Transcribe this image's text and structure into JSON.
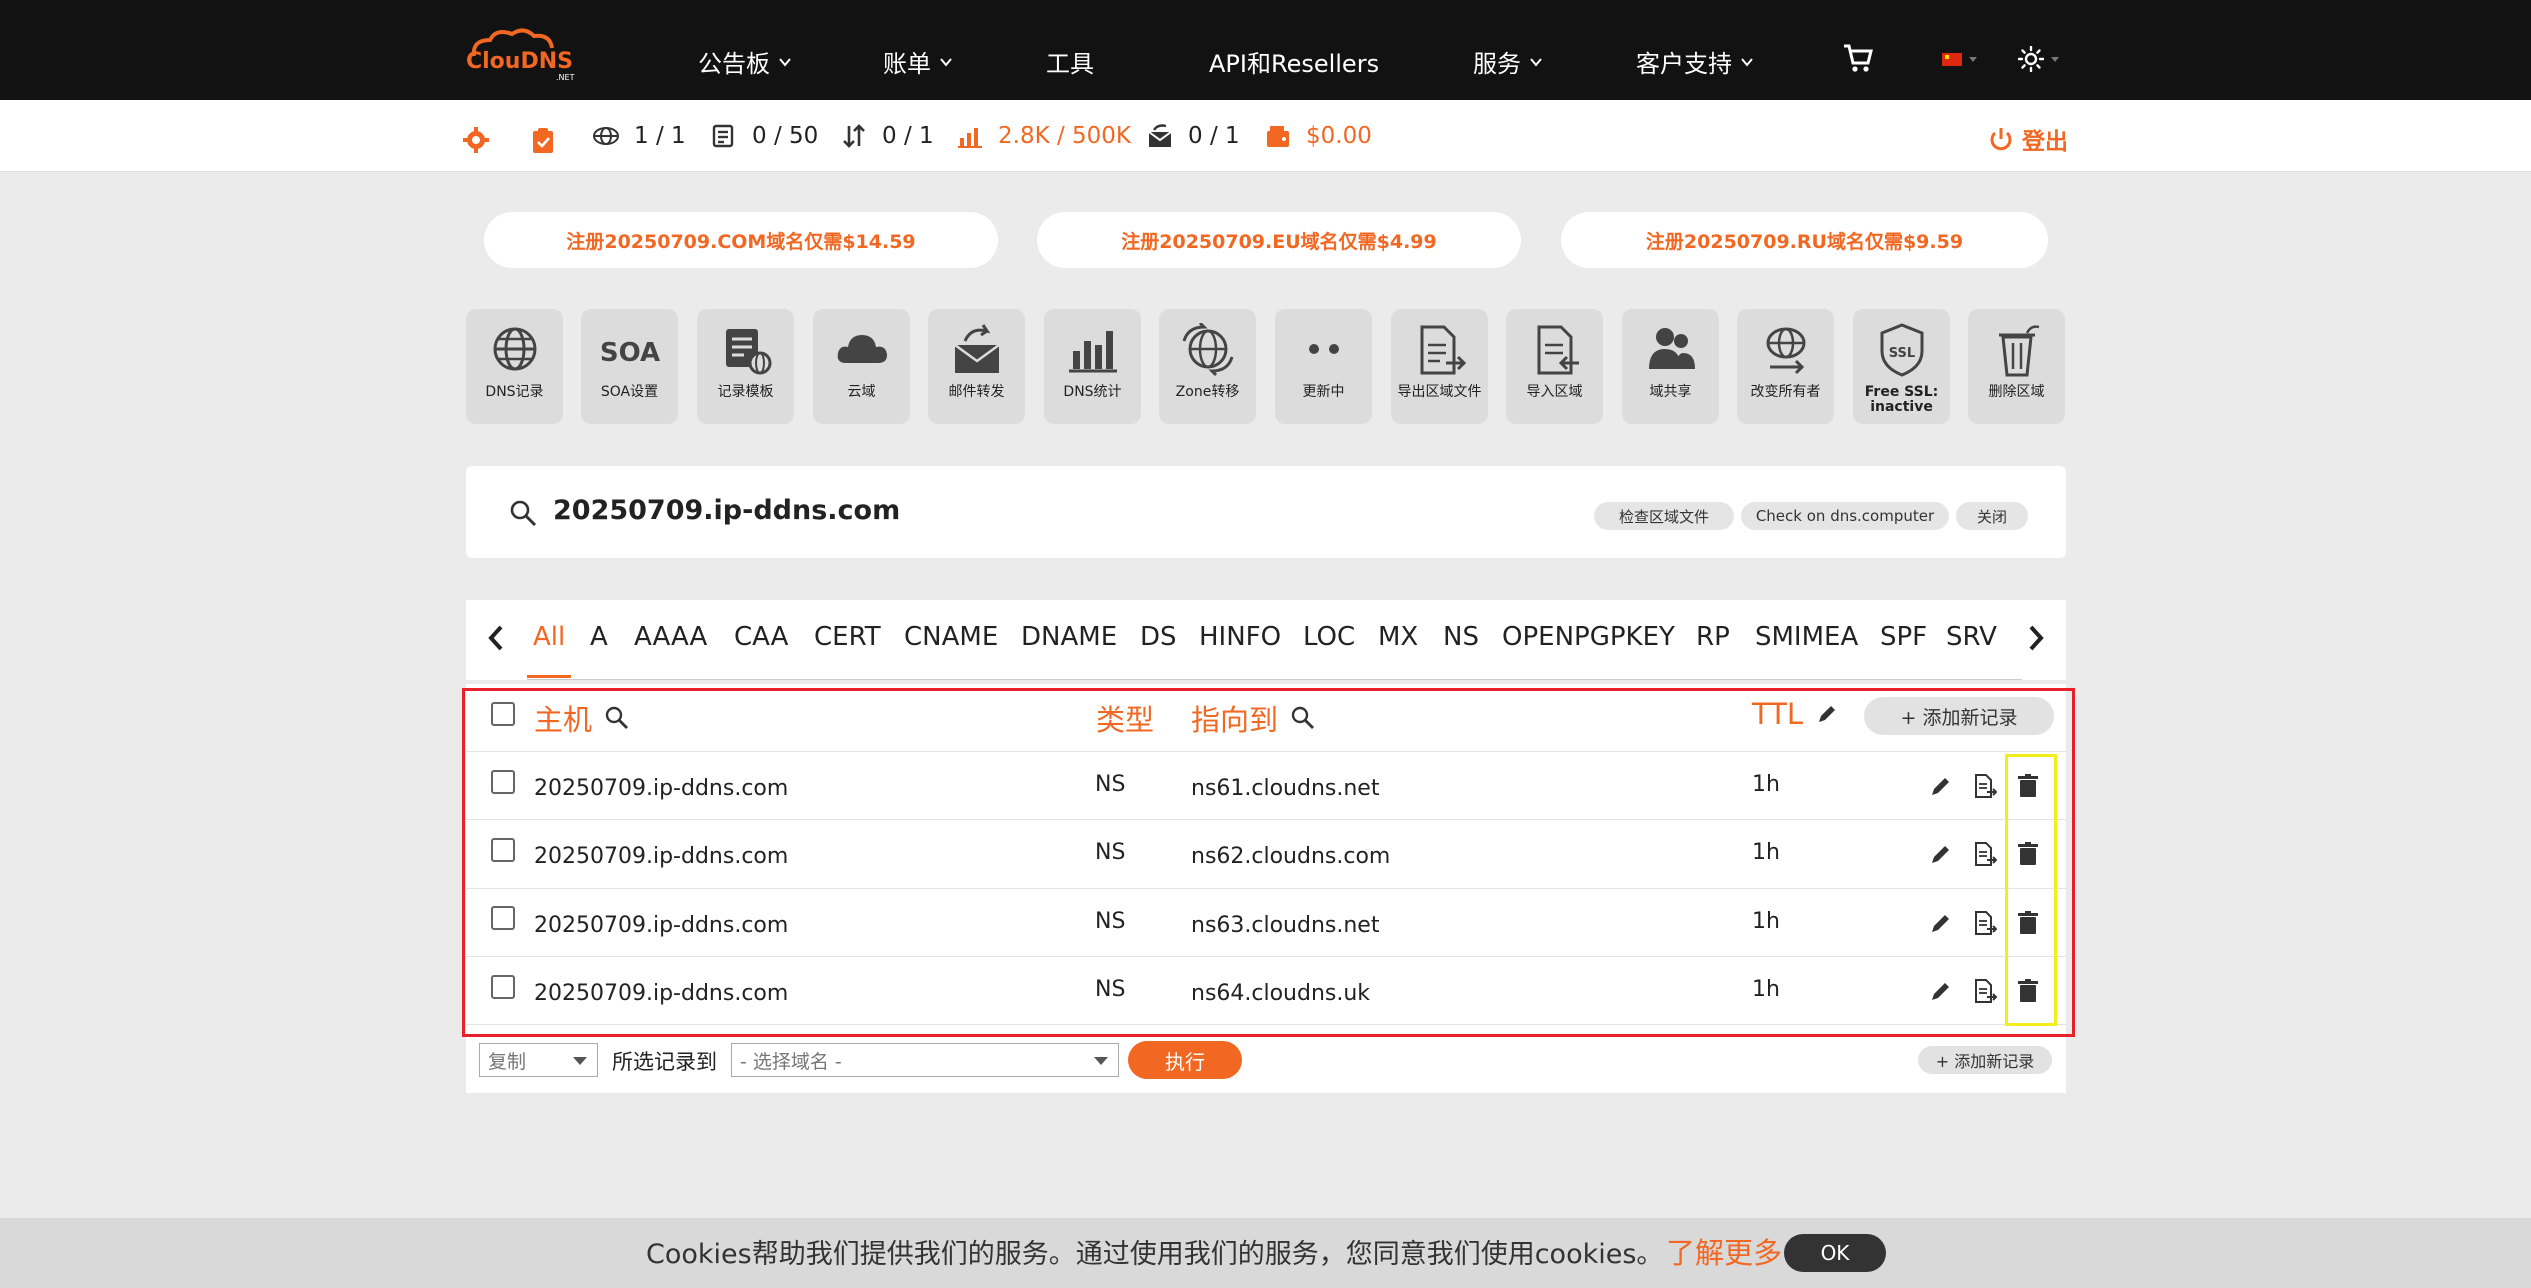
{
  "brand": {
    "logo_text": "ClouDNS",
    "logo_sub": ".NET"
  },
  "nav": {
    "items": [
      {
        "label": "公告板",
        "has_dropdown": true
      },
      {
        "label": "账单",
        "has_dropdown": true
      },
      {
        "label": "工具",
        "has_dropdown": false
      },
      {
        "label": "API和Resellers",
        "has_dropdown": false
      },
      {
        "label": "服务",
        "has_dropdown": true
      },
      {
        "label": "客户支持",
        "has_dropdown": true
      }
    ],
    "icons": [
      "cart-icon",
      "flag-cn-icon",
      "theme-sun-icon"
    ]
  },
  "stats": {
    "zones": "1 / 1",
    "records": "0 / 50",
    "transfers": "0 / 1",
    "queries": "2.8K / 500K",
    "mail_forwards": "0 / 1",
    "balance": "$0.00",
    "logout_label": "登出"
  },
  "promos": [
    "注册20250709.COM域名仅需$14.59",
    "注册20250709.EU域名仅需$4.99",
    "注册20250709.RU域名仅需$9.59"
  ],
  "tools": [
    {
      "label": "DNS记录",
      "icon": "globe-icon"
    },
    {
      "label": "SOA设置",
      "icon": "soa-text-icon"
    },
    {
      "label": "记录模板",
      "icon": "template-icon"
    },
    {
      "label": "云域",
      "icon": "cloud-icon"
    },
    {
      "label": "邮件转发",
      "icon": "mail-forward-icon"
    },
    {
      "label": "DNS统计",
      "icon": "bar-chart-icon"
    },
    {
      "label": "Zone转移",
      "icon": "globe-transfer-icon"
    },
    {
      "label": "更新中",
      "icon": "dots-icon"
    },
    {
      "label": "导出区域文件",
      "icon": "export-file-icon"
    },
    {
      "label": "导入区域",
      "icon": "import-file-icon"
    },
    {
      "label": "域共享",
      "icon": "users-icon"
    },
    {
      "label": "改变所有者",
      "icon": "globe-arrow-icon"
    },
    {
      "label": "Free SSL: inactive",
      "icon": "ssl-shield-icon"
    },
    {
      "label": "删除区域",
      "icon": "trash-can-icon"
    }
  ],
  "zone": {
    "name": "20250709.ip-ddns.com",
    "buttons": [
      "检查区域文件",
      "Check on dns.computer",
      "关闭"
    ]
  },
  "record_types": [
    "All",
    "A",
    "AAAA",
    "CAA",
    "CERT",
    "CNAME",
    "DNAME",
    "DS",
    "HINFO",
    "LOC",
    "MX",
    "NS",
    "OPENPGPKEY",
    "RP",
    "SMIMEA",
    "SPF",
    "SRV"
  ],
  "active_type": "All",
  "table": {
    "headers": {
      "host": "主机",
      "type": "类型",
      "points_to": "指向到",
      "ttl": "TTL"
    },
    "add_label": "+ 添加新记录",
    "rows": [
      {
        "host": "20250709.ip-ddns.com",
        "type": "NS",
        "points_to": "ns61.cloudns.net",
        "ttl": "1h"
      },
      {
        "host": "20250709.ip-ddns.com",
        "type": "NS",
        "points_to": "ns62.cloudns.com",
        "ttl": "1h"
      },
      {
        "host": "20250709.ip-ddns.com",
        "type": "NS",
        "points_to": "ns63.cloudns.net",
        "ttl": "1h"
      },
      {
        "host": "20250709.ip-ddns.com",
        "type": "NS",
        "points_to": "ns64.cloudns.uk",
        "ttl": "1h"
      }
    ]
  },
  "bulk": {
    "action_value": "复制",
    "to_label": "所选记录到",
    "domain_placeholder": "- 选择域名 -",
    "execute_label": "执行",
    "add_label": "+ 添加新记录"
  },
  "cookie": {
    "text": "Cookies帮助我们提供我们的服务。通过使用我们的服务，您同意我们使用cookies。",
    "link": "了解更多",
    "ok": "OK"
  },
  "colors": {
    "accent": "#f26722",
    "highlight_red": "#e8202a",
    "highlight_yellow": "#f3ee1a",
    "topbar": "#121212"
  }
}
